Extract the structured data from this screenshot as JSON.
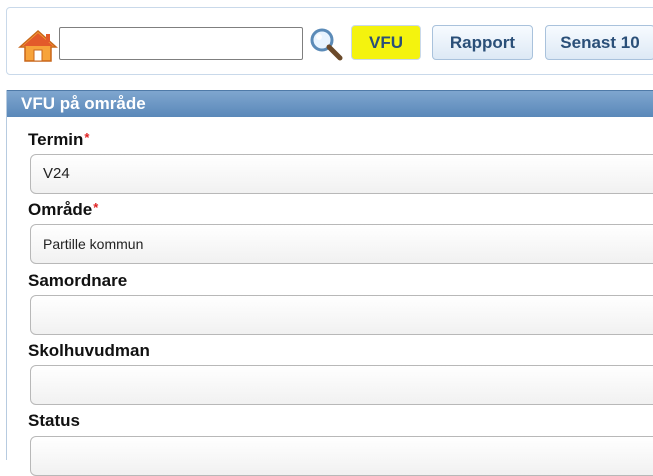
{
  "toolbar": {
    "home_icon": "home-icon",
    "search_value": "",
    "search_icon": "magnifier-icon",
    "buttons": [
      {
        "label": "VFU",
        "highlight_color": "#f4f30e"
      },
      {
        "label": "Rapport"
      },
      {
        "label": "Senast 10"
      }
    ]
  },
  "panel": {
    "title": "VFU på område",
    "fields": [
      {
        "label": "Termin",
        "required": true,
        "value": "V24"
      },
      {
        "label": "Område",
        "required": true,
        "value": "Partille kommun"
      },
      {
        "label": "Samordnare",
        "required": false,
        "value": ""
      },
      {
        "label": "Skolhuvudman",
        "required": false,
        "value": ""
      },
      {
        "label": "Status",
        "required": false,
        "value": ""
      }
    ],
    "required_marker": "*"
  },
  "colors": {
    "header_bg": "#6a95c4",
    "button_text": "#2a4f78",
    "required": "#e02020",
    "highlight": "#f4f30e"
  }
}
